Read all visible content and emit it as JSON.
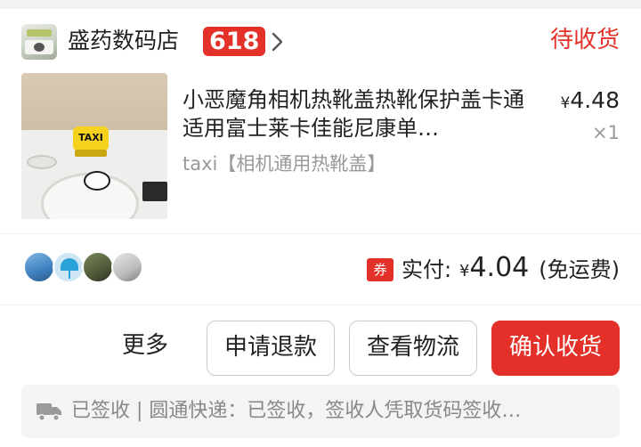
{
  "shop": {
    "name": "盛药数码店",
    "badge": "618",
    "status": "待收货"
  },
  "product": {
    "title": "小恶魔角相机热靴盖热靴保护盖卡通适用富士莱卡佳能尼康单…",
    "sku": "taxi【相机通用热靴盖】",
    "price_symbol": "¥",
    "price_value": "4.48",
    "quantity": "×1",
    "thumbnail_label": "TAXI"
  },
  "payment": {
    "coupon_icon": "券",
    "label": "实付:",
    "symbol": "¥",
    "amount": "4.04",
    "note": "(免运费)"
  },
  "actions": {
    "more": "更多",
    "refund": "申请退款",
    "logistics": "查看物流",
    "confirm": "确认收货"
  },
  "logistics": {
    "text": "已签收 | 圆通快递：已签收，签收人凭取货码签收…"
  },
  "colors": {
    "accent": "#e3312a",
    "muted_text": "#999999",
    "bar_bg": "#f4f4f4"
  },
  "icons": [
    "shop-logo",
    "chevron-right-icon",
    "coupon-icon",
    "truck-icon"
  ]
}
